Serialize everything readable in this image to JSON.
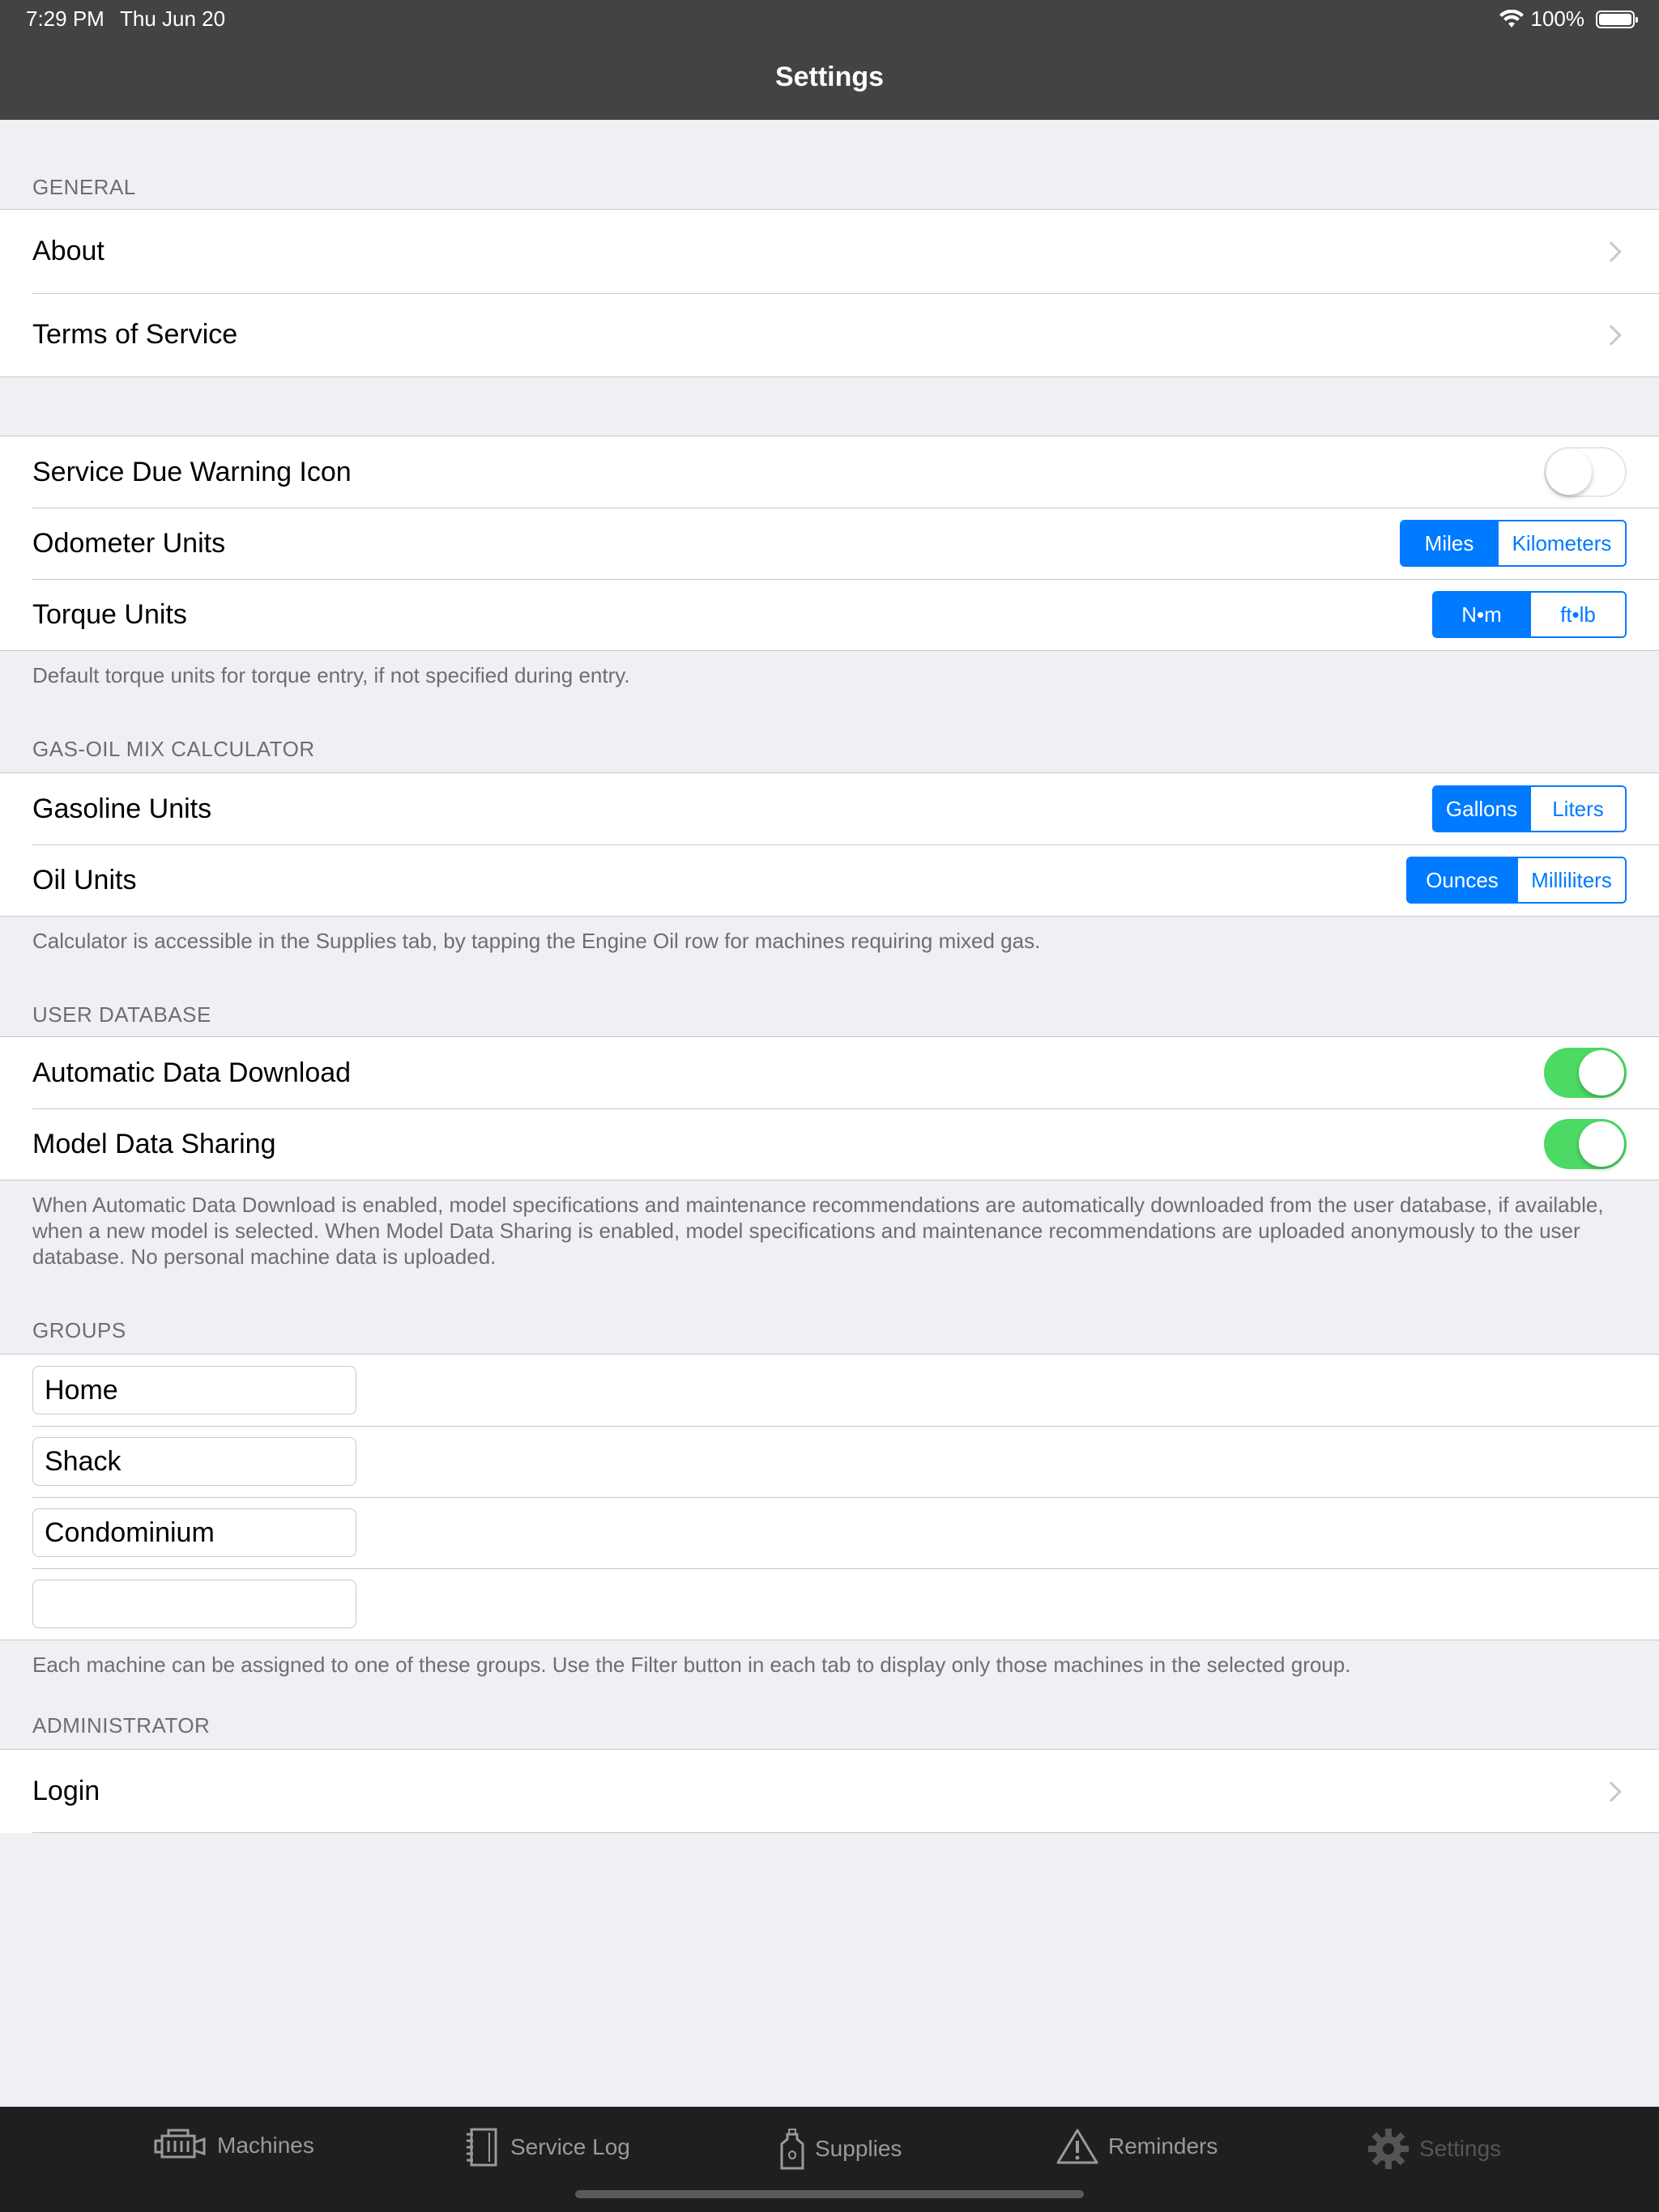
{
  "status": {
    "time": "7:29 PM",
    "date": "Thu Jun 20",
    "battery": "100%"
  },
  "nav": {
    "title": "Settings"
  },
  "general": {
    "header": "GENERAL",
    "items": [
      {
        "label": "About"
      },
      {
        "label": "Terms of Service"
      }
    ]
  },
  "units": {
    "service_warning_label": "Service Due Warning Icon",
    "service_warning_on": false,
    "odometer": {
      "label": "Odometer Units",
      "options": [
        "Miles",
        "Kilometers"
      ],
      "selected": "Miles"
    },
    "torque": {
      "label": "Torque Units",
      "options": [
        "N•m",
        "ft•lb"
      ],
      "selected": "N•m"
    },
    "footer": "Default torque units for torque entry, if not specified during entry."
  },
  "gas_oil": {
    "header": "GAS-OIL MIX CALCULATOR",
    "gasoline": {
      "label": "Gasoline Units",
      "options": [
        "Gallons",
        "Liters"
      ],
      "selected": "Gallons"
    },
    "oil": {
      "label": "Oil Units",
      "options": [
        "Ounces",
        "Milliliters"
      ],
      "selected": "Ounces"
    },
    "footer": "Calculator is accessible in the Supplies tab, by tapping the Engine Oil row for machines requiring mixed gas."
  },
  "user_db": {
    "header": "USER DATABASE",
    "auto_download": {
      "label": "Automatic Data Download",
      "on": true
    },
    "sharing": {
      "label": "Model Data Sharing",
      "on": true
    },
    "footer": "When Automatic Data Download is enabled, model specifications and maintenance recommendations are automatically downloaded from the user database, if available, when a new model is selected.  When Model Data Sharing is enabled, model specifications and maintenance recommendations are uploaded anonymously to the user database. No personal machine data is uploaded."
  },
  "groups": {
    "header": "GROUPS",
    "fields": [
      "Home",
      "Shack",
      "Condominium",
      ""
    ],
    "footer": "Each machine can be assigned to one of these groups. Use the Filter button in each tab to display only those machines in the selected group."
  },
  "admin": {
    "header": "ADMINISTRATOR",
    "login": "Login"
  },
  "tabs": [
    {
      "label": "Machines",
      "icon": "engine-icon"
    },
    {
      "label": "Service Log",
      "icon": "notebook-icon"
    },
    {
      "label": "Supplies",
      "icon": "oil-bottle-icon"
    },
    {
      "label": "Reminders",
      "icon": "warning-triangle-icon"
    },
    {
      "label": "Settings",
      "icon": "gear-icon",
      "active": true
    }
  ],
  "colors": {
    "accent": "#007aff",
    "toggle_on": "#4cd964",
    "navbar": "#434343",
    "tabbar": "#1f1f1f"
  }
}
